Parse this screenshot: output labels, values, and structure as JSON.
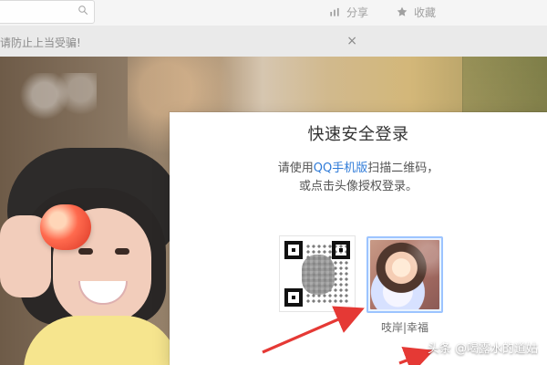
{
  "topbar": {
    "nav": [
      {
        "label": "分享",
        "icon": "bar-chart-icon"
      },
      {
        "label": "收藏",
        "icon": "star-icon"
      }
    ]
  },
  "notice": {
    "text": "请防止上当受骗!",
    "close": "×"
  },
  "login_modal": {
    "title": "快速安全登录",
    "desc_prefix": "请使用",
    "desc_link": "QQ手机版",
    "desc_suffix": "扫描二维码，",
    "desc_line2": "或点击头像授权登录。",
    "avatar_name": "吱岸|幸福"
  },
  "watermark": {
    "text": "头条 @喝露水的道姑"
  },
  "colors": {
    "link_blue": "#2f7bd8",
    "arrow_red": "#e53935",
    "avatar_border": "#9cc4ff"
  }
}
